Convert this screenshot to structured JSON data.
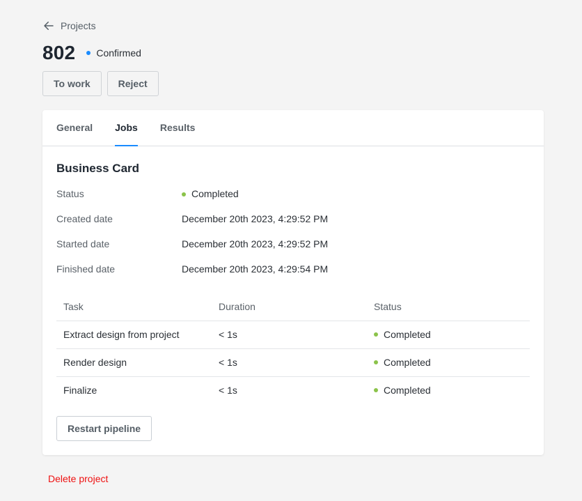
{
  "breadcrumb": {
    "back_label": "Projects"
  },
  "project": {
    "title": "802",
    "status": "Confirmed",
    "status_color": "#1a8cff"
  },
  "actions": {
    "to_work": "To work",
    "reject": "Reject"
  },
  "tabs": [
    {
      "label": "General",
      "active": false
    },
    {
      "label": "Jobs",
      "active": true
    },
    {
      "label": "Results",
      "active": false
    }
  ],
  "job": {
    "title": "Business Card",
    "properties": [
      {
        "label": "Status",
        "value": "Completed"
      },
      {
        "label": "Created date",
        "value": "December 20th 2023, 4:29:52 PM"
      },
      {
        "label": "Started date",
        "value": "December 20th 2023, 4:29:52 PM"
      },
      {
        "label": "Finished date",
        "value": "December 20th 2023, 4:29:54 PM"
      }
    ],
    "status_color": "#8bc34a",
    "table": {
      "headers": [
        "Task",
        "Duration",
        "Status"
      ],
      "rows": [
        {
          "task": "Extract design from project",
          "duration": "< 1s",
          "status": "Completed"
        },
        {
          "task": "Render design",
          "duration": "< 1s",
          "status": "Completed"
        },
        {
          "task": "Finalize",
          "duration": "< 1s",
          "status": "Completed"
        }
      ]
    },
    "restart_label": "Restart pipeline"
  },
  "delete_label": "Delete project",
  "colors": {
    "accent": "#1a8cff",
    "danger": "#ee1111",
    "success": "#8bc34a"
  }
}
